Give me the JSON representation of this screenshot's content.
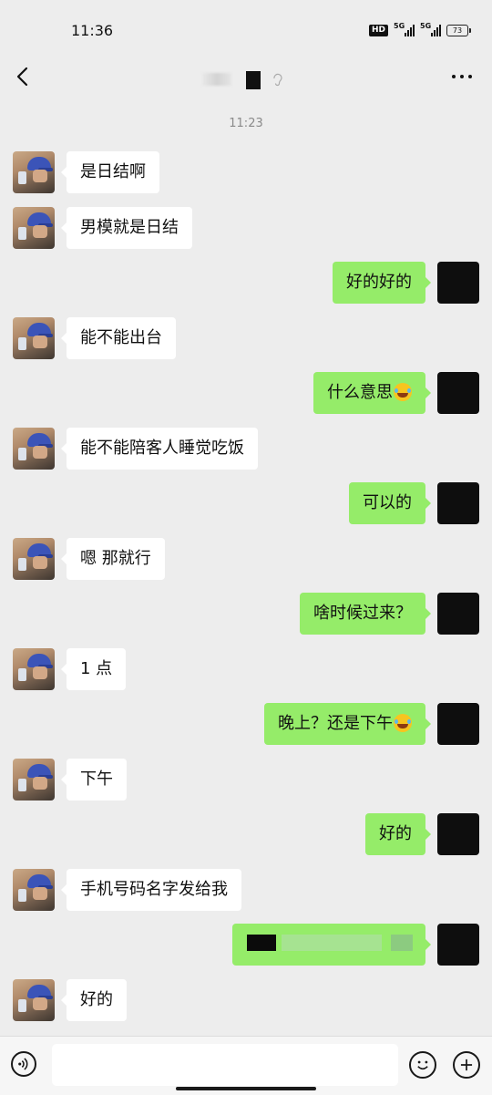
{
  "status_bar": {
    "time": "11:36",
    "hd_label": "HD",
    "signal_1_label": "5G",
    "signal_2_label": "5G",
    "battery": "73"
  },
  "header": {
    "contact_name_blurred": true
  },
  "chat": {
    "timestamp": "11:23",
    "messages": [
      {
        "side": "in",
        "text": "是日结啊"
      },
      {
        "side": "in",
        "text": "男模就是日结"
      },
      {
        "side": "out",
        "text": "好的好的"
      },
      {
        "side": "in",
        "text": "能不能出台"
      },
      {
        "side": "out",
        "text": "什么意思",
        "emoji": "joy-emoji"
      },
      {
        "side": "in",
        "text": "能不能陪客人睡觉吃饭"
      },
      {
        "side": "out",
        "text": "可以的"
      },
      {
        "side": "in",
        "text": "嗯 那就行"
      },
      {
        "side": "out",
        "text": "啥时候过来？"
      },
      {
        "side": "in",
        "text": "1 点"
      },
      {
        "side": "out",
        "text": "晚上？还是下午",
        "emoji": "joy-emoji"
      },
      {
        "side": "in",
        "text": "下午"
      },
      {
        "side": "out",
        "text": "好的"
      },
      {
        "side": "in",
        "text": "手机号码名字发给我"
      },
      {
        "side": "out",
        "text": "",
        "pixelated": true
      },
      {
        "side": "in",
        "text": "好的"
      }
    ]
  },
  "input_bar": {
    "placeholder": "",
    "voice_icon": "voice-icon",
    "emoji_icon": "emoji-icon",
    "plus_icon": "plus-icon"
  }
}
